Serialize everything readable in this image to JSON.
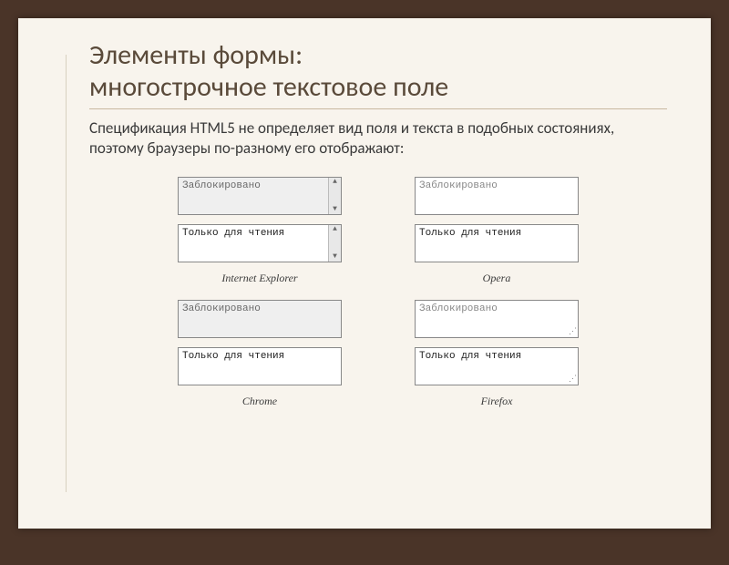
{
  "heading_l1": "Элементы формы:",
  "heading_l2": "многострочное текстовое поле",
  "body": "Спецификация HTML5 не определяет вид поля и текста в подобных состояниях, поэтому браузеры по-разному его отображают:",
  "labels": {
    "disabled": "Заблокировано",
    "readonly": "Только для чтения"
  },
  "browsers": {
    "ie": "Internet Explorer",
    "opera": "Opera",
    "chrome": "Chrome",
    "firefox": "Firefox"
  }
}
